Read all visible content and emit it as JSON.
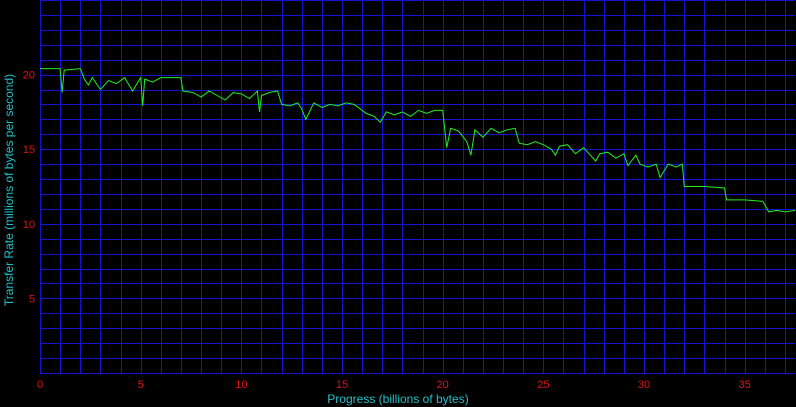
{
  "chart_data": {
    "type": "line",
    "xlabel": "Progress (billions of bytes)",
    "ylabel": "Transfer Rate (millions of bytes per second)",
    "xlim": [
      0,
      37.5
    ],
    "ylim": [
      0,
      25
    ],
    "grid": true,
    "x_ticks": [
      0,
      5,
      10,
      15,
      20,
      25,
      30,
      35
    ],
    "y_ticks": [
      5,
      10,
      15,
      20
    ],
    "x_tick_labels": [
      "0",
      "5",
      "10",
      "15",
      "20",
      "25",
      "30",
      "35"
    ],
    "y_tick_labels": [
      "5",
      "10",
      "15",
      "20"
    ],
    "colors": {
      "background": "#000000",
      "grid": "#1414d2",
      "line": "#22ee22",
      "tick_label": "#e01010",
      "axis_title": "#21c0c8"
    },
    "series": [
      {
        "x": [
          0,
          1.0,
          1.1,
          1.2,
          2.0,
          2.2,
          2.4,
          2.6,
          3.0,
          3.4,
          3.8,
          4.2,
          4.6,
          5.0,
          5.1,
          5.2,
          5.6,
          6.0,
          7.0,
          7.1,
          7.6,
          8.0,
          8.4,
          8.8,
          9.2,
          9.6,
          10.0,
          10.4,
          10.8,
          10.9,
          11.0,
          11.4,
          11.8,
          12.0,
          12.4,
          12.8,
          13.0,
          13.2,
          13.6,
          14.0,
          14.4,
          14.8,
          15.2,
          15.6,
          16.0,
          16.2,
          16.6,
          16.9,
          17.2,
          17.6,
          18.0,
          18.4,
          18.8,
          19.2,
          19.6,
          20.0,
          20.2,
          20.4,
          20.8,
          21.2,
          21.4,
          21.6,
          22.0,
          22.4,
          22.8,
          23.2,
          23.6,
          23.8,
          24.2,
          24.6,
          25.0,
          25.4,
          25.6,
          25.8,
          26.2,
          26.6,
          27.0,
          27.4,
          27.6,
          27.8,
          28.2,
          28.6,
          29.0,
          29.2,
          29.6,
          29.8,
          30.2,
          30.6,
          30.8,
          31.2,
          31.6,
          31.9,
          32.0,
          33.0,
          34.0,
          34.1,
          35.0,
          35.9,
          36.2,
          36.6,
          37.0,
          37.5
        ],
        "values": [
          20.4,
          20.4,
          18.8,
          20.3,
          20.4,
          19.7,
          19.3,
          19.8,
          19.0,
          19.6,
          19.4,
          19.8,
          18.9,
          19.8,
          17.9,
          19.7,
          19.5,
          19.8,
          19.8,
          18.9,
          18.8,
          18.5,
          18.9,
          18.6,
          18.3,
          18.8,
          18.7,
          18.4,
          18.9,
          17.5,
          18.6,
          18.8,
          18.9,
          18.0,
          17.9,
          18.1,
          17.7,
          17.0,
          18.1,
          17.8,
          18.0,
          17.9,
          18.1,
          18.0,
          17.6,
          17.4,
          17.2,
          16.8,
          17.5,
          17.3,
          17.5,
          17.2,
          17.6,
          17.4,
          17.6,
          17.6,
          15.1,
          16.4,
          16.2,
          15.5,
          14.6,
          16.3,
          15.8,
          16.4,
          16.1,
          16.3,
          16.4,
          15.4,
          15.3,
          15.5,
          15.3,
          15.0,
          14.6,
          15.2,
          15.3,
          14.7,
          15.1,
          14.5,
          14.2,
          14.7,
          14.8,
          14.4,
          14.7,
          13.9,
          14.6,
          14.0,
          13.8,
          14.0,
          13.1,
          14.0,
          13.8,
          14.0,
          12.5,
          12.5,
          12.4,
          11.6,
          11.6,
          11.5,
          10.8,
          10.9,
          10.8,
          10.9
        ]
      }
    ]
  }
}
